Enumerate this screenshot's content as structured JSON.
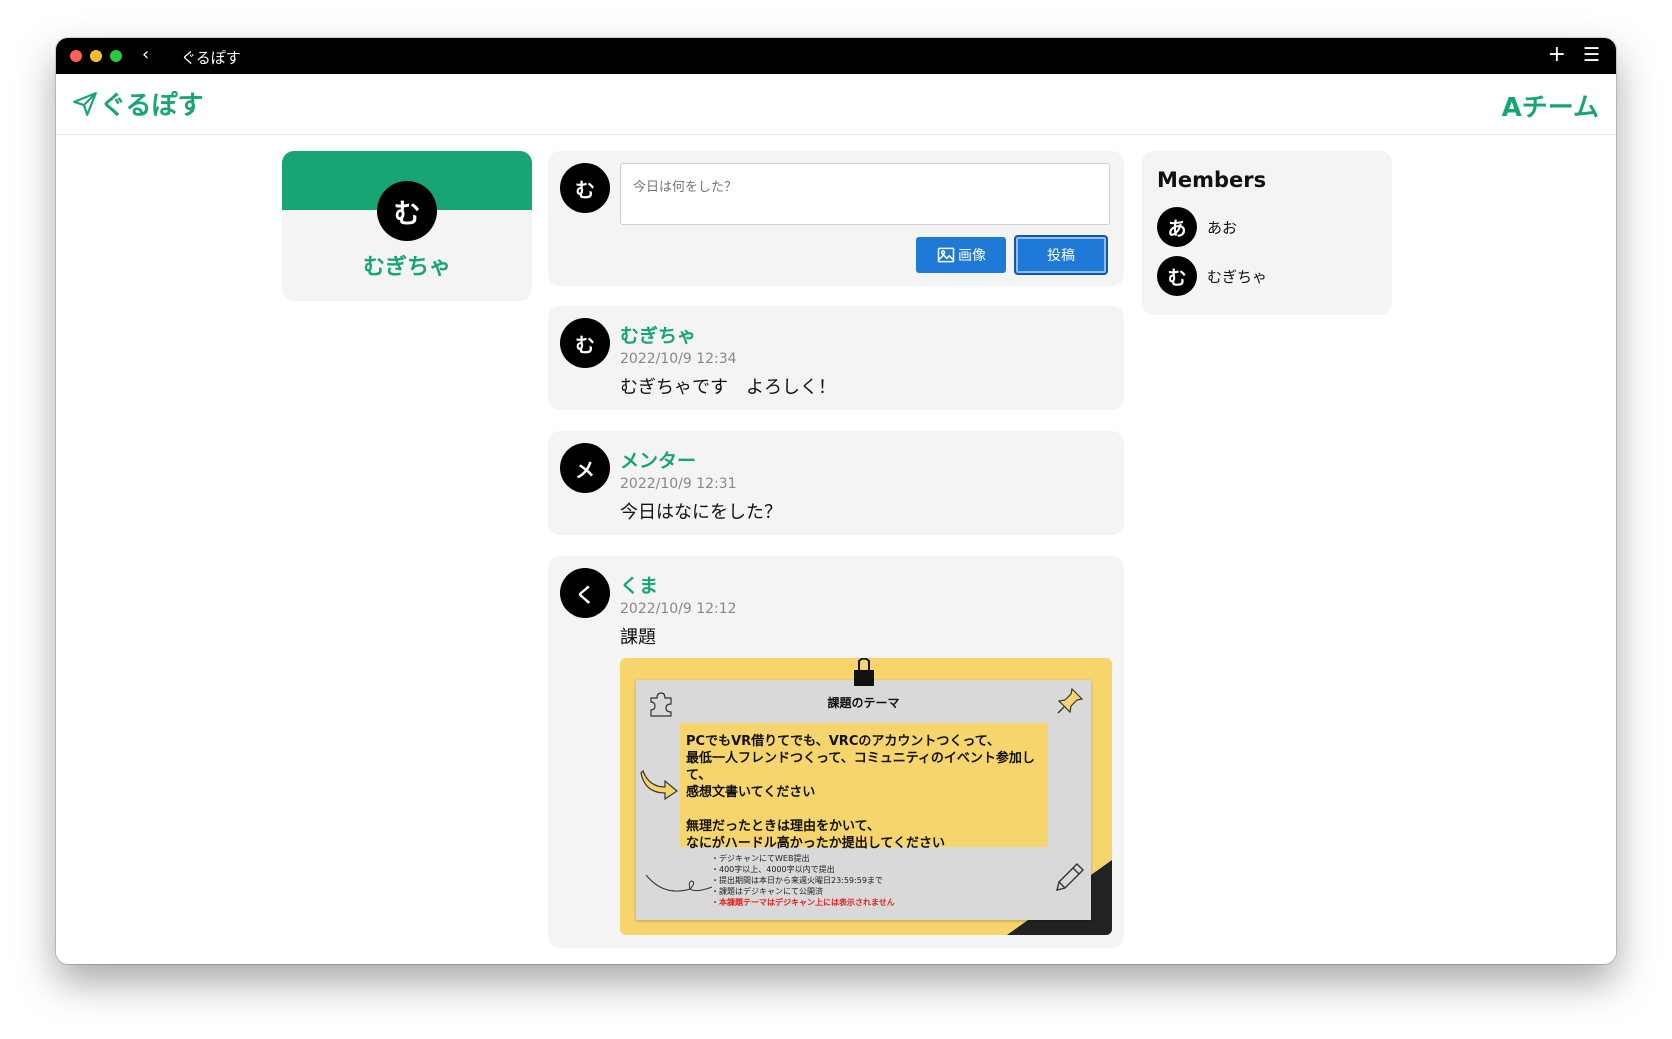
{
  "window": {
    "title": "ぐるぽす",
    "back_icon": "chevron-left-icon",
    "new_tab_icon": "plus-icon",
    "menu_icon": "hamburger-icon"
  },
  "header": {
    "logo_icon": "paper-plane-icon",
    "logo_text": "ぐるぽす",
    "team_name": "Aチーム"
  },
  "profile": {
    "avatar_initial": "む",
    "name": "むぎちゃ"
  },
  "composer": {
    "avatar_initial": "む",
    "placeholder": "今日は何をした？",
    "image_button_label": "画像",
    "image_button_icon": "image-icon",
    "post_button_label": "投稿"
  },
  "posts": [
    {
      "avatar_initial": "む",
      "author": "むぎちゃ",
      "timestamp": "2022/10/9 12:34",
      "body": "むぎちゃです　よろしく！"
    },
    {
      "avatar_initial": "メ",
      "author": "メンター",
      "timestamp": "2022/10/9 12:31",
      "body": "今日はなにをした？"
    },
    {
      "avatar_initial": "く",
      "author": "くま",
      "timestamp": "2022/10/9 12:12",
      "body": "課題",
      "attachment": {
        "title": "課題のテーマ",
        "note_lines_1": [
          "PCでもVR借りてでも、VRCのアカウントつくって、",
          "最低一人フレンドつくって、コミュニティのイベント参加して、",
          "感想文書いてください"
        ],
        "note_lines_2": [
          "無理だったときは理由をかいて、",
          "なにがハードル高かったか提出してください"
        ],
        "rules": [
          "・デジキャンにてWEB提出",
          "・400字以上、4000字以内で提出",
          "・提出期間は本日から来週火曜日23:59:59まで",
          "・課題はデジキャンにて公開済"
        ],
        "warning": "・本課題テーマはデジキャン上には表示されません",
        "accent_color": "#f7d56d"
      }
    }
  ],
  "members": {
    "title": "Members",
    "list": [
      {
        "initial": "あ",
        "name": "あお"
      },
      {
        "initial": "む",
        "name": "むぎちゃ"
      }
    ]
  },
  "colors": {
    "brand": "#17a673",
    "button": "#1e7ad6",
    "card_bg": "#f4f4f4"
  }
}
